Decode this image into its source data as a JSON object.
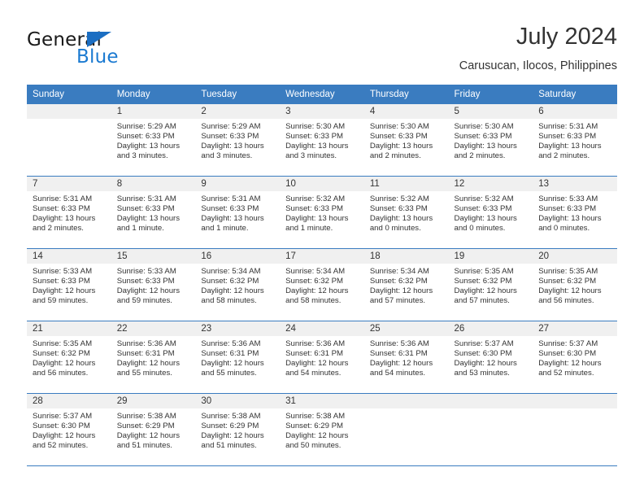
{
  "brand": {
    "name_part1": "General",
    "name_part2": "Blue",
    "triangle_color": "#1b6ec2",
    "blue_color": "#1b7ad1"
  },
  "header": {
    "title": "July 2024",
    "subtitle": "Carusucan, Ilocos, Philippines"
  },
  "theme": {
    "header_blue": "#3a7cc0",
    "daynum_band": "#f0f0f0",
    "text": "#333333"
  },
  "calendar": {
    "weekday_headers": [
      "Sunday",
      "Monday",
      "Tuesday",
      "Wednesday",
      "Thursday",
      "Friday",
      "Saturday"
    ],
    "weeks": [
      [
        {
          "day": "",
          "lines": []
        },
        {
          "day": "1",
          "lines": [
            "Sunrise: 5:29 AM",
            "Sunset: 6:33 PM",
            "Daylight: 13 hours",
            "and 3 minutes."
          ]
        },
        {
          "day": "2",
          "lines": [
            "Sunrise: 5:29 AM",
            "Sunset: 6:33 PM",
            "Daylight: 13 hours",
            "and 3 minutes."
          ]
        },
        {
          "day": "3",
          "lines": [
            "Sunrise: 5:30 AM",
            "Sunset: 6:33 PM",
            "Daylight: 13 hours",
            "and 3 minutes."
          ]
        },
        {
          "day": "4",
          "lines": [
            "Sunrise: 5:30 AM",
            "Sunset: 6:33 PM",
            "Daylight: 13 hours",
            "and 2 minutes."
          ]
        },
        {
          "day": "5",
          "lines": [
            "Sunrise: 5:30 AM",
            "Sunset: 6:33 PM",
            "Daylight: 13 hours",
            "and 2 minutes."
          ]
        },
        {
          "day": "6",
          "lines": [
            "Sunrise: 5:31 AM",
            "Sunset: 6:33 PM",
            "Daylight: 13 hours",
            "and 2 minutes."
          ]
        }
      ],
      [
        {
          "day": "7",
          "lines": [
            "Sunrise: 5:31 AM",
            "Sunset: 6:33 PM",
            "Daylight: 13 hours",
            "and 2 minutes."
          ]
        },
        {
          "day": "8",
          "lines": [
            "Sunrise: 5:31 AM",
            "Sunset: 6:33 PM",
            "Daylight: 13 hours",
            "and 1 minute."
          ]
        },
        {
          "day": "9",
          "lines": [
            "Sunrise: 5:31 AM",
            "Sunset: 6:33 PM",
            "Daylight: 13 hours",
            "and 1 minute."
          ]
        },
        {
          "day": "10",
          "lines": [
            "Sunrise: 5:32 AM",
            "Sunset: 6:33 PM",
            "Daylight: 13 hours",
            "and 1 minute."
          ]
        },
        {
          "day": "11",
          "lines": [
            "Sunrise: 5:32 AM",
            "Sunset: 6:33 PM",
            "Daylight: 13 hours",
            "and 0 minutes."
          ]
        },
        {
          "day": "12",
          "lines": [
            "Sunrise: 5:32 AM",
            "Sunset: 6:33 PM",
            "Daylight: 13 hours",
            "and 0 minutes."
          ]
        },
        {
          "day": "13",
          "lines": [
            "Sunrise: 5:33 AM",
            "Sunset: 6:33 PM",
            "Daylight: 13 hours",
            "and 0 minutes."
          ]
        }
      ],
      [
        {
          "day": "14",
          "lines": [
            "Sunrise: 5:33 AM",
            "Sunset: 6:33 PM",
            "Daylight: 12 hours",
            "and 59 minutes."
          ]
        },
        {
          "day": "15",
          "lines": [
            "Sunrise: 5:33 AM",
            "Sunset: 6:33 PM",
            "Daylight: 12 hours",
            "and 59 minutes."
          ]
        },
        {
          "day": "16",
          "lines": [
            "Sunrise: 5:34 AM",
            "Sunset: 6:32 PM",
            "Daylight: 12 hours",
            "and 58 minutes."
          ]
        },
        {
          "day": "17",
          "lines": [
            "Sunrise: 5:34 AM",
            "Sunset: 6:32 PM",
            "Daylight: 12 hours",
            "and 58 minutes."
          ]
        },
        {
          "day": "18",
          "lines": [
            "Sunrise: 5:34 AM",
            "Sunset: 6:32 PM",
            "Daylight: 12 hours",
            "and 57 minutes."
          ]
        },
        {
          "day": "19",
          "lines": [
            "Sunrise: 5:35 AM",
            "Sunset: 6:32 PM",
            "Daylight: 12 hours",
            "and 57 minutes."
          ]
        },
        {
          "day": "20",
          "lines": [
            "Sunrise: 5:35 AM",
            "Sunset: 6:32 PM",
            "Daylight: 12 hours",
            "and 56 minutes."
          ]
        }
      ],
      [
        {
          "day": "21",
          "lines": [
            "Sunrise: 5:35 AM",
            "Sunset: 6:32 PM",
            "Daylight: 12 hours",
            "and 56 minutes."
          ]
        },
        {
          "day": "22",
          "lines": [
            "Sunrise: 5:36 AM",
            "Sunset: 6:31 PM",
            "Daylight: 12 hours",
            "and 55 minutes."
          ]
        },
        {
          "day": "23",
          "lines": [
            "Sunrise: 5:36 AM",
            "Sunset: 6:31 PM",
            "Daylight: 12 hours",
            "and 55 minutes."
          ]
        },
        {
          "day": "24",
          "lines": [
            "Sunrise: 5:36 AM",
            "Sunset: 6:31 PM",
            "Daylight: 12 hours",
            "and 54 minutes."
          ]
        },
        {
          "day": "25",
          "lines": [
            "Sunrise: 5:36 AM",
            "Sunset: 6:31 PM",
            "Daylight: 12 hours",
            "and 54 minutes."
          ]
        },
        {
          "day": "26",
          "lines": [
            "Sunrise: 5:37 AM",
            "Sunset: 6:30 PM",
            "Daylight: 12 hours",
            "and 53 minutes."
          ]
        },
        {
          "day": "27",
          "lines": [
            "Sunrise: 5:37 AM",
            "Sunset: 6:30 PM",
            "Daylight: 12 hours",
            "and 52 minutes."
          ]
        }
      ],
      [
        {
          "day": "28",
          "lines": [
            "Sunrise: 5:37 AM",
            "Sunset: 6:30 PM",
            "Daylight: 12 hours",
            "and 52 minutes."
          ]
        },
        {
          "day": "29",
          "lines": [
            "Sunrise: 5:38 AM",
            "Sunset: 6:29 PM",
            "Daylight: 12 hours",
            "and 51 minutes."
          ]
        },
        {
          "day": "30",
          "lines": [
            "Sunrise: 5:38 AM",
            "Sunset: 6:29 PM",
            "Daylight: 12 hours",
            "and 51 minutes."
          ]
        },
        {
          "day": "31",
          "lines": [
            "Sunrise: 5:38 AM",
            "Sunset: 6:29 PM",
            "Daylight: 12 hours",
            "and 50 minutes."
          ]
        },
        {
          "day": "",
          "lines": []
        },
        {
          "day": "",
          "lines": []
        },
        {
          "day": "",
          "lines": []
        }
      ]
    ]
  }
}
